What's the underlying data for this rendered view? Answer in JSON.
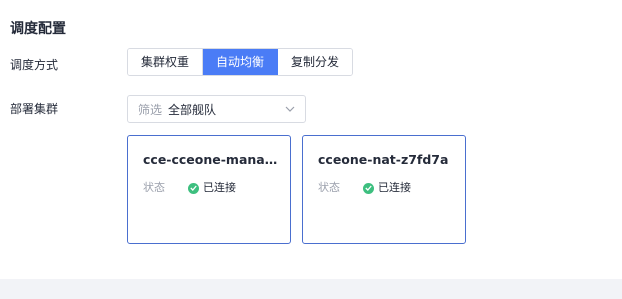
{
  "section": {
    "title": "调度配置"
  },
  "mode": {
    "label": "调度方式",
    "options": [
      {
        "label": "集群权重",
        "active": false
      },
      {
        "label": "自动均衡",
        "active": true
      },
      {
        "label": "复制分发",
        "active": false
      }
    ]
  },
  "cluster": {
    "label": "部署集群",
    "filter_prefix": "筛选",
    "filter_value": "全部舰队"
  },
  "cards": [
    {
      "name": "cce-cceone-manage...",
      "status_label": "状态",
      "status_text": "已连接"
    },
    {
      "name": "cceone-nat-z7fd7a",
      "status_label": "状态",
      "status_text": "已连接"
    }
  ],
  "colors": {
    "accent": "#4a7cf6",
    "card_border": "#4a6fcf",
    "status_ok": "#3dbf7f"
  },
  "icons": {
    "select_arrow": "chevron-down-icon",
    "status": "check-circle-icon"
  }
}
